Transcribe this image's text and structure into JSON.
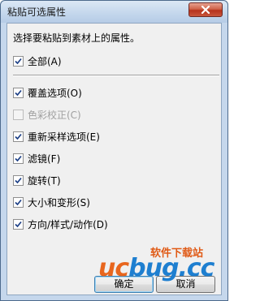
{
  "window": {
    "title": "粘贴可选属性"
  },
  "prompt": "选择要粘贴到素材上的属性。",
  "all_option": {
    "label": "全部(A)",
    "checked": true
  },
  "options": [
    {
      "label": "覆盖选项(O)",
      "checked": true,
      "enabled": true
    },
    {
      "label": "色彩校正(C)",
      "checked": false,
      "enabled": false
    },
    {
      "label": "重新采样选项(E)",
      "checked": true,
      "enabled": true
    },
    {
      "label": "滤镜(F)",
      "checked": true,
      "enabled": true
    },
    {
      "label": "旋转(T)",
      "checked": true,
      "enabled": true
    },
    {
      "label": "大小和变形(S)",
      "checked": true,
      "enabled": true
    },
    {
      "label": "方向/样式/动作(D)",
      "checked": true,
      "enabled": true
    }
  ],
  "buttons": {
    "ok": "确定",
    "cancel": "取消"
  },
  "watermark": {
    "brand": "ucbug.cc",
    "tagline": "软件下载站"
  },
  "colors": {
    "checkmark": "#1c3f86",
    "watermark_orange": "#e8661e",
    "watermark_blue": "#1e7fd0"
  }
}
